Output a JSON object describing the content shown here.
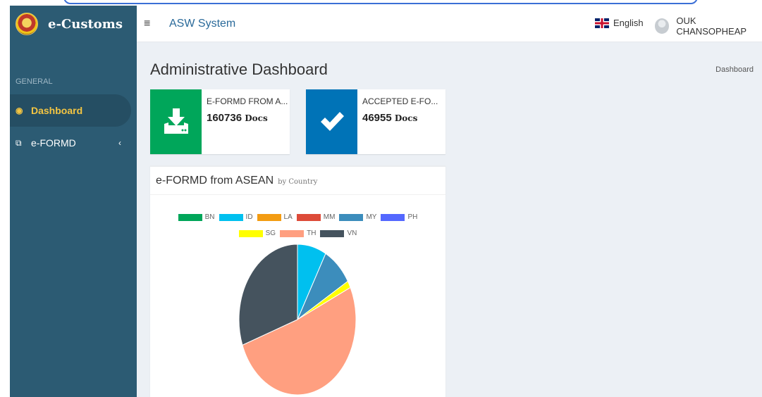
{
  "sidebar": {
    "brand": "e-Customs",
    "section": "GENERAL",
    "items": [
      {
        "label": "Dashboard",
        "icon": "dashboard-icon"
      },
      {
        "label": "e-FORMD",
        "icon": "copy-icon"
      }
    ]
  },
  "topbar": {
    "title": "ASW System",
    "language": "English",
    "user": "OUK CHANSOPHEAP"
  },
  "page": {
    "title": "Administrative Dashboard",
    "breadcrumb": "Dashboard"
  },
  "stats": [
    {
      "label": "E-FORMD FROM A...",
      "value": "160736",
      "unit": "Docs",
      "color": "#00a65a",
      "icon": "download-icon"
    },
    {
      "label": "ACCEPTED E-FO...",
      "value": "46955",
      "unit": "Docs",
      "color": "#0073b7",
      "icon": "check-icon"
    }
  ],
  "chart_card": {
    "title": "e-FORMD from ASEAN",
    "subtitle": "by Country"
  },
  "chart_data": {
    "type": "pie",
    "categories": [
      "BN",
      "ID",
      "LA",
      "MM",
      "MY",
      "PH",
      "SG",
      "TH",
      "VN"
    ],
    "values": [
      0,
      8,
      0,
      0,
      8.5,
      0,
      1.5,
      51.5,
      30.5
    ],
    "colors": [
      "#00a65a",
      "#00c0ef",
      "#f39c12",
      "#dd4b39",
      "#3c8dbc",
      "#5468ff",
      "#ffff00",
      "#ff9f80",
      "#45535e"
    ],
    "legend": "top"
  }
}
